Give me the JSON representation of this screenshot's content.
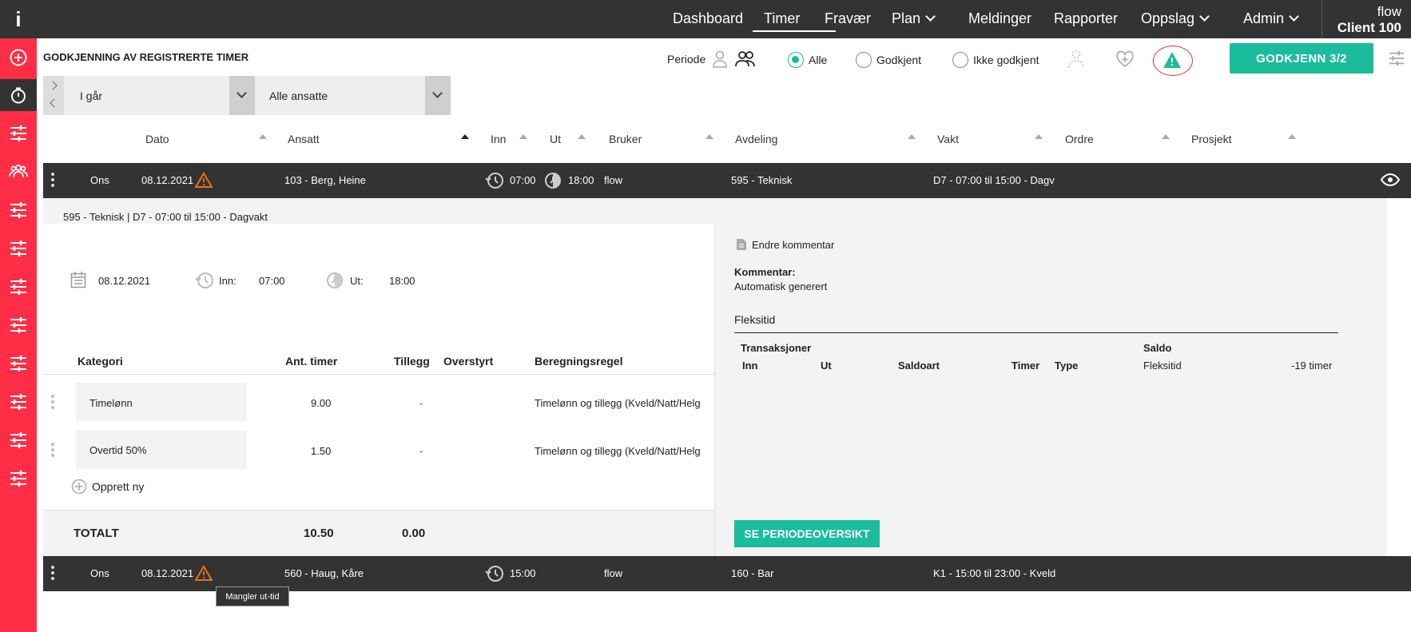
{
  "nav": {
    "logo": "i",
    "items": [
      {
        "label": "Dashboard",
        "chevron": false
      },
      {
        "label": "Timer",
        "chevron": false,
        "active": true
      },
      {
        "label": "Fravær",
        "chevron": false
      },
      {
        "label": "Plan",
        "chevron": true
      },
      {
        "label": "Meldinger",
        "chevron": false
      },
      {
        "label": "Rapporter",
        "chevron": false
      },
      {
        "label": "Oppslag",
        "chevron": true
      },
      {
        "label": "Admin",
        "chevron": true
      }
    ],
    "client_top": "flow",
    "client_name": "Client 100"
  },
  "header": {
    "title": "GODKJENNING AV REGISTRERTE TIMER",
    "periode": "Periode",
    "filter_all": "Alle",
    "filter_approved": "Godkjent",
    "filter_not_approved": "Ikke godkjent",
    "approve_button": "GODKJENN 3/2"
  },
  "filters": {
    "period_value": "I går",
    "employee_value": "Alle ansatte"
  },
  "columns": {
    "dato": "Dato",
    "ansatt": "Ansatt",
    "inn": "Inn",
    "ut": "Ut",
    "bruker": "Bruker",
    "avdeling": "Avdeling",
    "vakt": "Vakt",
    "ordre": "Ordre",
    "prosjekt": "Prosjekt"
  },
  "rows": [
    {
      "day": "Ons",
      "date": "08.12.2021",
      "employee": "103 - Berg, Heine",
      "in": "07:00",
      "out": "18:00",
      "user": "flow",
      "department": "595 - Teknisk",
      "shift": "D7 - 07:00 til 15:00 - Dagv"
    },
    {
      "day": "Ons",
      "date": "08.12.2021",
      "employee": "560 - Haug, Kåre",
      "in": "15:00",
      "out": "",
      "user": "flow",
      "department": "160 - Bar",
      "shift": "K1 - 15:00 til 23:00 - Kveld"
    }
  ],
  "detail": {
    "heading": "595 - Teknisk | D7 - 07:00 til 15:00 - Dagvakt",
    "date": "08.12.2021",
    "inn_label": "Inn:",
    "inn_value": "07:00",
    "ut_label": "Ut:",
    "ut_value": "18:00",
    "table_headers": {
      "kategori": "Kategori",
      "ant_timer": "Ant. timer",
      "tillegg": "Tillegg",
      "overstyrt": "Overstyrt",
      "beregningsregel": "Beregningsregel"
    },
    "lines": [
      {
        "kategori": "Timelønn",
        "timer": "9.00",
        "tillegg": "-",
        "regel": "Timelønn og tillegg (Kveld/Natt/Helg"
      },
      {
        "kategori": "Overtid 50%",
        "timer": "1.50",
        "tillegg": "-",
        "regel": "Timelønn og tillegg (Kveld/Natt/Helg"
      }
    ],
    "create_new": "Opprett ny",
    "total_label": "TOTALT",
    "total_hours": "10.50",
    "total_tillegg": "0.00",
    "edit_comment": "Endre kommentar",
    "comment_label": "Kommentar:",
    "comment_value": "Automatisk generert",
    "flex_title": "Fleksitid",
    "transactions": "Transaksjoner",
    "saldo": "Saldo",
    "flex_headers": {
      "inn": "Inn",
      "ut": "Ut",
      "saldoart": "Saldoart",
      "timer": "Timer",
      "type": "Type"
    },
    "flex_type": "Fleksitid",
    "flex_value": "-19 timer",
    "period_button": "SE PERIODEOVERSIKT"
  },
  "tooltip": "Mangler ut-tid",
  "colors": {
    "accent": "#1bbc9b",
    "sidebar": "#ff2d46",
    "dark": "#333333",
    "warning": "#e8731a"
  }
}
